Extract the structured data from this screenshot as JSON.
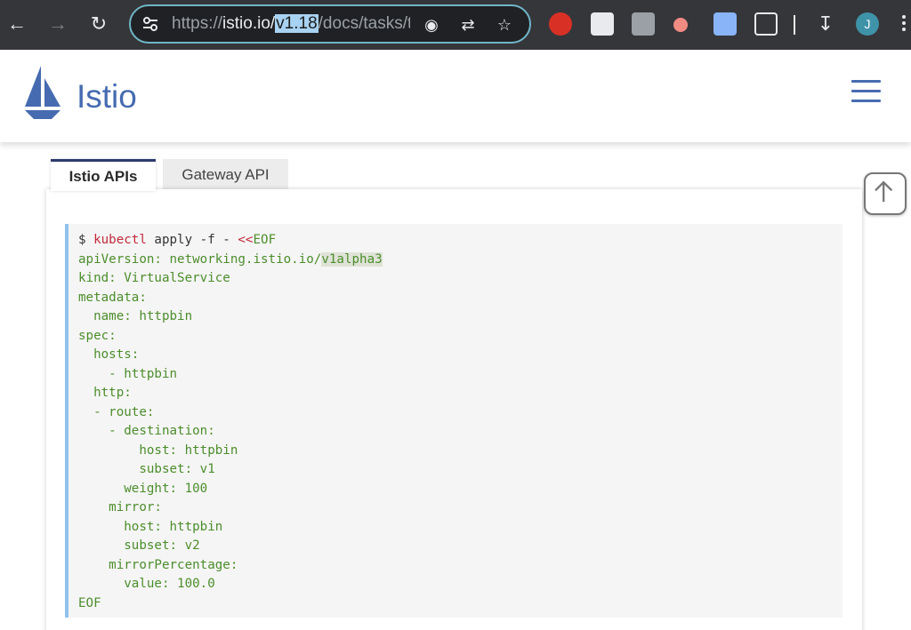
{
  "browser": {
    "url_prefix": "https://",
    "url_host": "istio.io",
    "url_sep": "/",
    "url_selected": "v1.18",
    "url_rest": "/docs/tasks/t",
    "avatar_letter": "J",
    "accent": "#6fb6c7"
  },
  "header": {
    "brand": "Istio",
    "brand_color": "#466bb0"
  },
  "tabs": [
    {
      "label": "Istio APIs",
      "active": true
    },
    {
      "label": "Gateway API",
      "active": false
    }
  ],
  "code": {
    "prompt": "$ ",
    "command": "kubectl",
    "args": " apply -f - ",
    "heredoc_op": "<<",
    "heredoc_tag": "EOF",
    "api_prefix": "apiVersion: networking.istio.io/",
    "api_version": "v1alpha3",
    "lines": [
      "kind: VirtualService",
      "metadata:",
      "  name: httpbin",
      "spec:",
      "  hosts:",
      "    - httpbin",
      "  http:",
      "  - route:",
      "    - destination:",
      "        host: httpbin",
      "        subset: v1",
      "      weight: 100",
      "    mirror:",
      "      host: httpbin",
      "      subset: v2",
      "    mirrorPercentage:",
      "      value: 100.0",
      "EOF"
    ]
  }
}
